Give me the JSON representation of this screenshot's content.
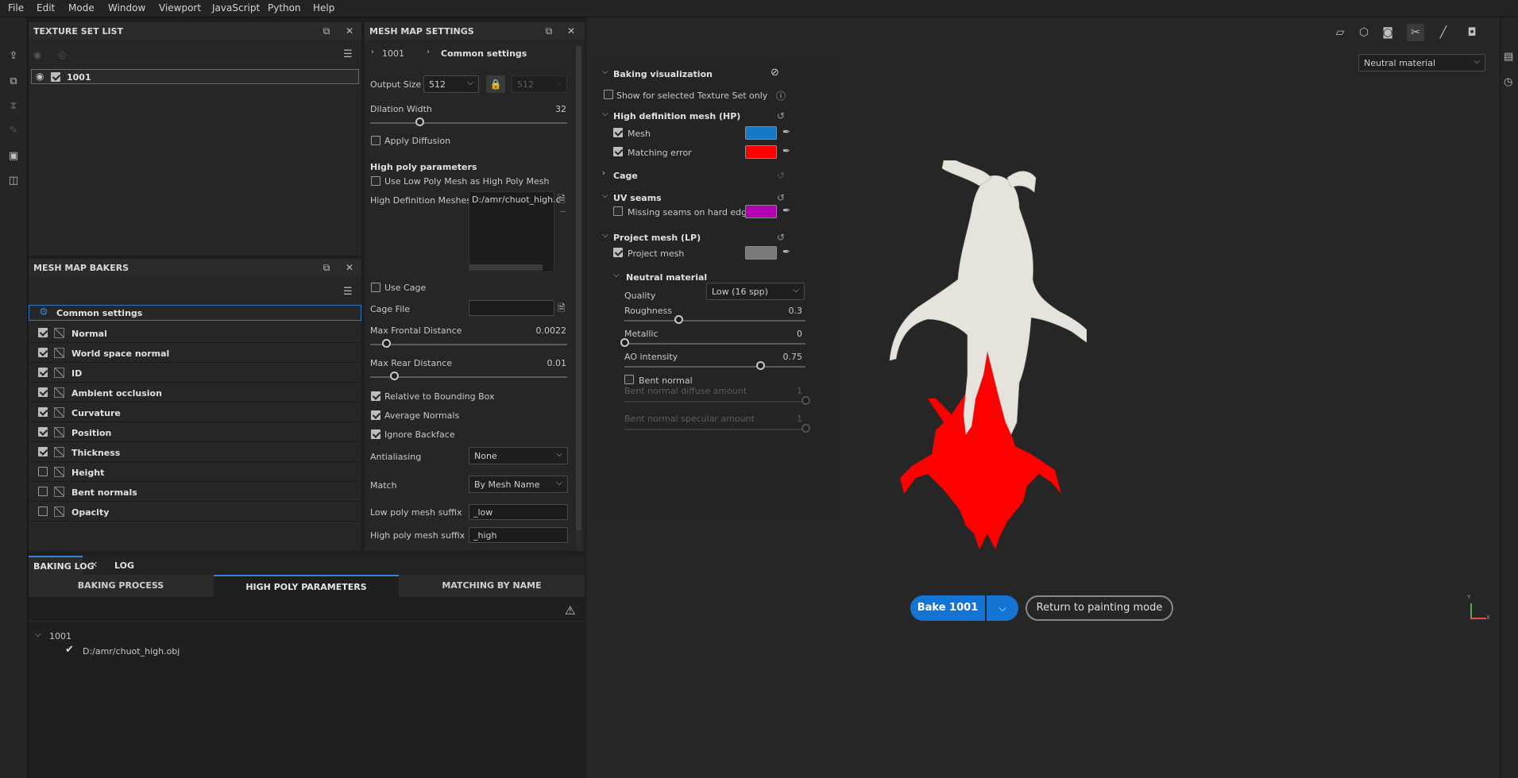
{
  "menu": [
    "File",
    "Edit",
    "Mode",
    "Window",
    "Viewport",
    "JavaScript",
    "Python",
    "Help"
  ],
  "texture_set_list": {
    "title": "TEXTURE SET LIST",
    "items": [
      {
        "name": "1001",
        "checked": true
      }
    ]
  },
  "mesh_map_bakers": {
    "title": "MESH MAP BAKERS",
    "common": "Common settings",
    "items": [
      {
        "name": "Normal",
        "checked": true
      },
      {
        "name": "World space normal",
        "checked": true
      },
      {
        "name": "ID",
        "checked": true
      },
      {
        "name": "Ambient occlusion",
        "checked": true
      },
      {
        "name": "Curvature",
        "checked": true
      },
      {
        "name": "Position",
        "checked": true
      },
      {
        "name": "Thickness",
        "checked": true
      },
      {
        "name": "Height",
        "checked": false
      },
      {
        "name": "Bent normals",
        "checked": false
      },
      {
        "name": "Opacity",
        "checked": false
      }
    ]
  },
  "mesh_map_settings": {
    "title": "MESH MAP SETTINGS",
    "breadcrumb": [
      "1001",
      "Common settings"
    ],
    "output_size_label": "Output Size",
    "output_size": "512",
    "output_size_locked": "512",
    "dilation_label": "Dilation Width",
    "dilation_value": "32",
    "dilation_fraction": 0.25,
    "apply_diffusion": "Apply Diffusion",
    "high_poly_header": "High poly parameters",
    "use_low_poly": "Use Low Poly Mesh as High Poly Mesh",
    "hd_meshes_label": "High Definition Meshes",
    "hd_meshes_value": "D:/amr/chuot_high.c",
    "use_cage": "Use Cage",
    "cage_file_label": "Cage File",
    "max_frontal_label": "Max Frontal Distance",
    "max_frontal_value": "0.0022",
    "max_frontal_fraction": 0.08,
    "max_rear_label": "Max Rear Distance",
    "max_rear_value": "0.01",
    "max_rear_fraction": 0.12,
    "relative_bbox": "Relative to Bounding Box",
    "average_normals": "Average Normals",
    "ignore_backface": "Ignore Backface",
    "antialiasing_label": "Antialiasing",
    "antialiasing_value": "None",
    "match_label": "Match",
    "match_value": "By Mesh Name",
    "low_suffix_label": "Low poly mesh suffix",
    "low_suffix_value": "_low",
    "high_suffix_label": "High poly mesh suffix",
    "high_suffix_value": "_high"
  },
  "baking_log": {
    "tabs": [
      "BAKING LOG",
      "LOG"
    ],
    "subtabs": [
      "BAKING PROCESS",
      "HIGH POLY PARAMETERS",
      "MATCHING BY NAME"
    ],
    "tree_root": "1001",
    "tree_child": "D:/amr/chuot_high.obj"
  },
  "bake_panel": {
    "baking_visualization": "Baking visualization",
    "show_selected": "Show for selected Texture Set only",
    "hp_header": "High definition mesh (HP)",
    "mesh": "Mesh",
    "mesh_color": "#1479c9",
    "matching_error": "Matching error",
    "matching_error_color": "#ff0000",
    "cage": "Cage",
    "uv_seams": "UV seams",
    "missing_seams": "Missing seams on hard edges",
    "missing_seams_color": "#b400b4",
    "project_mesh_header": "Project mesh (LP)",
    "project_mesh": "Project mesh",
    "project_mesh_color": "#7a7a7a",
    "neutral_material": "Neutral material",
    "quality_label": "Quality",
    "quality_value": "Low (16 spp)",
    "roughness_label": "Roughness",
    "roughness_value": "0.3",
    "metallic_label": "Metallic",
    "metallic_value": "0",
    "ao_label": "AO intensity",
    "ao_value": "0.75",
    "bent_normal": "Bent normal",
    "bent_diffuse_label": "Bent normal diffuse amount",
    "bent_diffuse_value": "1",
    "bent_specular_label": "Bent normal specular amount",
    "bent_specular_value": "1"
  },
  "viewport": {
    "material_dropdown": "Neutral material",
    "bake_button": "Bake 1001",
    "return_button": "Return to painting mode"
  }
}
